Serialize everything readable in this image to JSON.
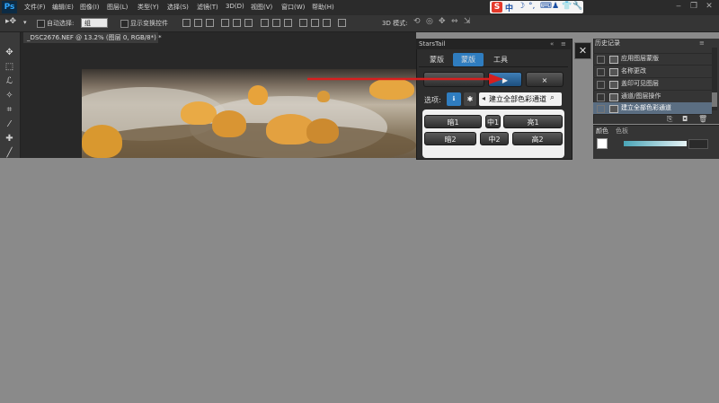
{
  "menubar": {
    "logo": "Ps",
    "items": [
      "文件(F)",
      "编辑(E)",
      "图像(I)",
      "图层(L)",
      "类型(Y)",
      "选择(S)",
      "滤镜(T)",
      "3D(D)",
      "视图(V)",
      "窗口(W)",
      "帮助(H)"
    ],
    "ime": {
      "s_logo": "S",
      "lang": "中"
    },
    "window_controls": [
      "‒",
      "❐",
      "✕"
    ]
  },
  "options": {
    "auto_select_label": "自动选择:",
    "auto_select_value": "组",
    "show_transform_label": "显示变换控件",
    "mode3d_label": "3D 模式:"
  },
  "document": {
    "tab_title": "_DSC2676.NEF @ 13.2% (图层 0, RGB/8*) *"
  },
  "starstail": {
    "title": "StarsTail",
    "tabs": [
      "蒙版",
      "蒙版",
      "工具"
    ],
    "active_tab": 1,
    "row1": [
      "",
      "▶",
      "×"
    ],
    "options_label": "选项:",
    "action_label": "建立全部色彩通道",
    "grid": [
      [
        "暗1",
        "中1",
        "亮1"
      ],
      [
        "暗2",
        "中2",
        "高2"
      ]
    ]
  },
  "history": {
    "tabs": [
      "历史记录"
    ],
    "items": [
      "应用图层蒙版",
      "名称更改",
      "盖印可见图层",
      "通道/图层操作",
      "建立全部色彩通道"
    ],
    "bottom_tabs": [
      "颜色",
      "色板"
    ]
  },
  "annotations": {
    "arrow_color": "#d61f1f"
  }
}
